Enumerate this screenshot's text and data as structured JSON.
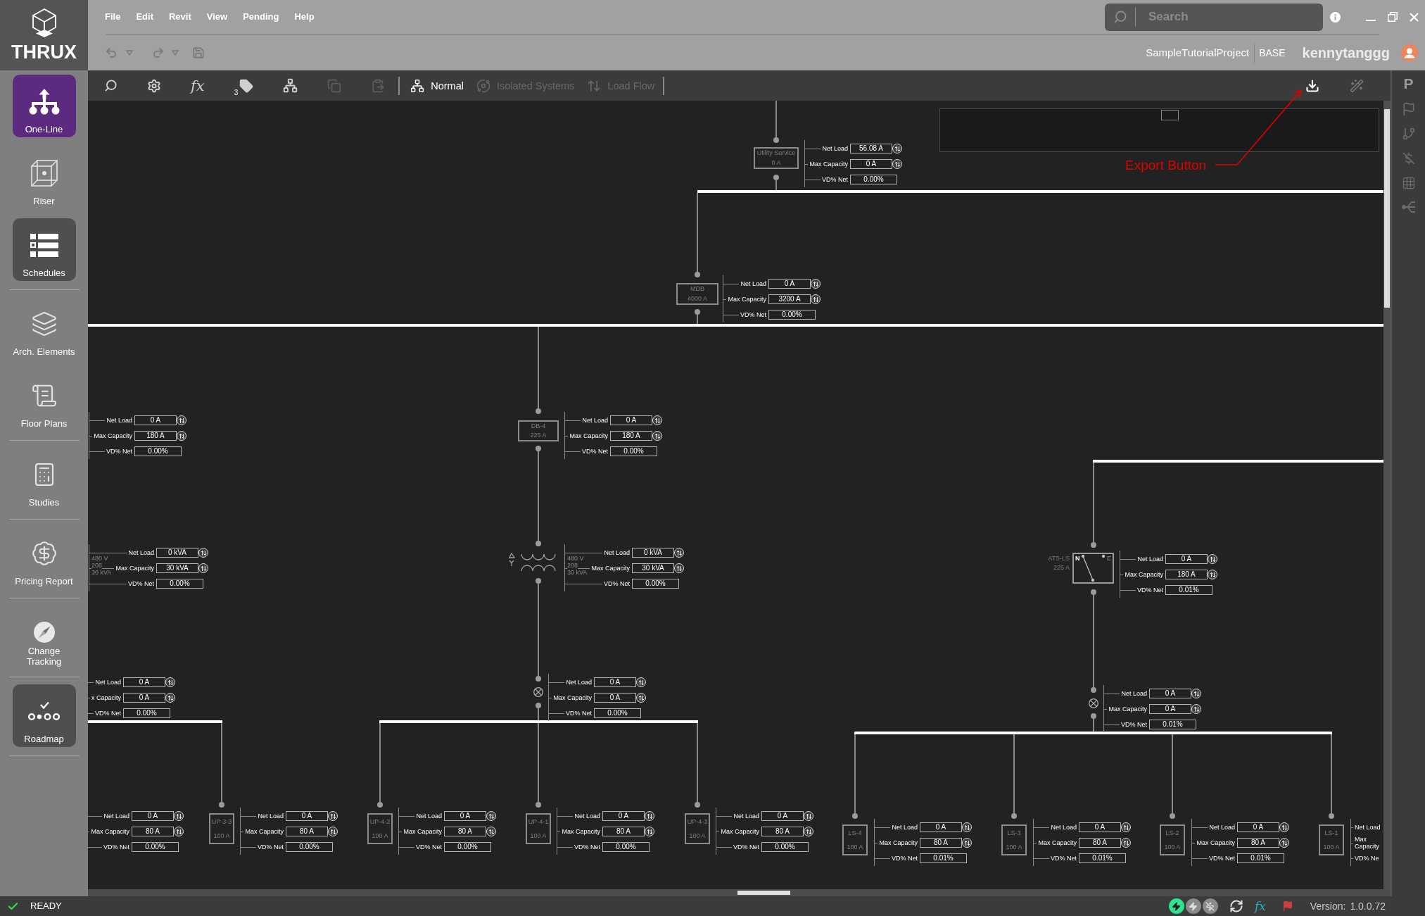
{
  "logo": {
    "text": "THRUX"
  },
  "sidebar": {
    "groups": [
      [
        {
          "label": "One-Line",
          "kind": "tile",
          "selected": true
        },
        {
          "label": "Riser",
          "kind": "plain",
          "selected": false
        },
        {
          "label": "Schedules",
          "kind": "tile",
          "selected": false
        }
      ],
      [
        {
          "label": "Arch. Elements",
          "kind": "plain",
          "selected": false
        },
        {
          "label": "Floor Plans",
          "kind": "plain",
          "selected": false
        }
      ],
      [
        {
          "label": "Studies",
          "kind": "plain",
          "selected": false
        }
      ],
      [
        {
          "label": "Pricing Report",
          "kind": "plain",
          "selected": false
        }
      ],
      [
        {
          "label": "Change Tracking",
          "kind": "plain",
          "selected": false
        }
      ],
      [
        {
          "label": "Roadmap",
          "kind": "tile",
          "selected": false
        }
      ]
    ]
  },
  "menu": [
    "File",
    "Edit",
    "Revit",
    "View",
    "Pending",
    "Help"
  ],
  "search": {
    "placeholder": "Search"
  },
  "project": {
    "name": "SampleTutorialProject",
    "branch": "BASE",
    "user": "kennytanggg"
  },
  "toolbar": {
    "tools": [
      {
        "disabled": false
      },
      {
        "disabled": false
      },
      {
        "disabled": false,
        "glyph": "fx"
      },
      {
        "disabled": false,
        "badge": "3"
      },
      {
        "disabled": false
      },
      {
        "disabled": true
      },
      {
        "disabled": true
      }
    ],
    "modes": [
      {
        "label": "Normal",
        "selected": true
      },
      {
        "label": "Isolated Systems",
        "selected": false
      },
      {
        "label": "Load Flow",
        "selected": false
      }
    ]
  },
  "right_rail": {
    "letter": "P"
  },
  "diagram": {
    "annotation": "Export Button",
    "nodes": [
      {
        "kind": "box",
        "name": "Utility Service",
        "rating": "0 A",
        "panel": {
          "rows": [
            {
              "kind": "toggle",
              "label": "Net Load",
              "value": "56.08 A"
            },
            {
              "kind": "toggle",
              "label": "Max Capacity",
              "value": "0 A"
            },
            {
              "kind": "plain",
              "label": "VD% Net",
              "value": "0.00%"
            }
          ]
        }
      },
      {
        "kind": "box",
        "name": "MDB",
        "rating": "4000 A",
        "panel": {
          "rows": [
            {
              "kind": "toggle",
              "label": "Net Load",
              "value": "0 A"
            },
            {
              "kind": "toggle",
              "label": "Max Capacity",
              "value": "3200 A"
            },
            {
              "kind": "plain",
              "label": "VD% Net",
              "value": "0.00%"
            }
          ]
        }
      },
      {
        "kind": "panel_only",
        "panel": {
          "rows": [
            {
              "kind": "toggle",
              "label": "Net Load",
              "value": "0 A"
            },
            {
              "kind": "toggle",
              "label": "Max Capacity",
              "value": "180 A"
            },
            {
              "kind": "plain",
              "label": "VD% Net",
              "value": "0.00%"
            }
          ]
        }
      },
      {
        "kind": "box",
        "name": "DB-4",
        "rating": "225 A",
        "panel": {
          "rows": [
            {
              "kind": "toggle",
              "label": "Net Load",
              "value": "0 A"
            },
            {
              "kind": "toggle",
              "label": "Max Capacity",
              "value": "180 A"
            },
            {
              "kind": "plain",
              "label": "VD% Net",
              "value": "0.00%"
            }
          ]
        }
      },
      {
        "kind": "panel_only",
        "panel": {
          "notes": [
            "480 V",
            "208",
            "30 kVA"
          ],
          "rows": [
            {
              "kind": "toggle",
              "label": "Net Load",
              "value": "0 kVA"
            },
            {
              "kind": "toggle",
              "label": "Max Capacity",
              "value": "30 kVA"
            },
            {
              "kind": "plain",
              "label": "VD% Net",
              "value": "0.00%"
            }
          ]
        }
      },
      {
        "kind": "transformer",
        "panel": {
          "notes": [
            "480 V",
            "208",
            "30 kVA"
          ],
          "rows": [
            {
              "kind": "toggle",
              "label": "Net Load",
              "value": "0 kVA"
            },
            {
              "kind": "toggle",
              "label": "Max Capacity",
              "value": "30 kVA"
            },
            {
              "kind": "plain",
              "label": "VD% Net",
              "value": "0.00%"
            }
          ]
        }
      },
      {
        "kind": "ats",
        "name": "ATS-LS",
        "rating": "225 A",
        "poles": [
          {
            "label": "N",
            "selected": true
          },
          {
            "label": "E",
            "selected": false
          }
        ],
        "panel": {
          "rows": [
            {
              "kind": "toggle",
              "label": "Net Load",
              "value": "0 A"
            },
            {
              "kind": "toggle",
              "label": "Max Capacity",
              "value": "180 A"
            },
            {
              "kind": "plain",
              "label": "VD% Net",
              "value": "0.01%"
            }
          ]
        }
      },
      {
        "kind": "panel_only",
        "panel": {
          "rows": [
            {
              "kind": "toggle",
              "label": "Net Load",
              "value": "0 A"
            },
            {
              "kind": "toggle",
              "label": "x Capacity",
              "value": "0 A"
            },
            {
              "kind": "plain",
              "label": "VD% Net",
              "value": "0.00%"
            }
          ]
        }
      },
      {
        "kind": "breaker",
        "panel": {
          "rows": [
            {
              "kind": "toggle",
              "label": "Net Load",
              "value": "0 A"
            },
            {
              "kind": "toggle",
              "label": "Max Capacity",
              "value": "0 A"
            },
            {
              "kind": "plain",
              "label": "VD% Net",
              "value": "0.00%"
            }
          ]
        }
      },
      {
        "kind": "breaker",
        "panel": {
          "rows": [
            {
              "kind": "toggle",
              "label": "Net Load",
              "value": "0 A"
            },
            {
              "kind": "toggle",
              "label": "Max Capacity",
              "value": "0 A"
            },
            {
              "kind": "plain",
              "label": "VD% Net",
              "value": "0.01%"
            }
          ]
        }
      },
      {
        "kind": "panel_only",
        "panel": {
          "rows": [
            {
              "kind": "toggle",
              "label": "Net Load",
              "value": "0 A"
            },
            {
              "kind": "toggle",
              "label": "Max Capacity",
              "value": "80 A"
            },
            {
              "kind": "plain",
              "label": "VD% Net",
              "value": "0.00%"
            }
          ]
        }
      },
      {
        "kind": "box",
        "name": "UP-3-3",
        "rating": "100 A",
        "panel": {
          "rows": [
            {
              "kind": "toggle",
              "label": "Net Load",
              "value": "0 A"
            },
            {
              "kind": "toggle",
              "label": "Max Capacity",
              "value": "80 A"
            },
            {
              "kind": "plain",
              "label": "VD% Net",
              "value": "0.00%"
            }
          ]
        }
      },
      {
        "kind": "box",
        "name": "UP-4-2",
        "rating": "100 A",
        "panel": {
          "rows": [
            {
              "kind": "toggle",
              "label": "Net Load",
              "value": "0 A"
            },
            {
              "kind": "toggle",
              "label": "Max Capacity",
              "value": "80 A"
            },
            {
              "kind": "plain",
              "label": "VD% Net",
              "value": "0.00%"
            }
          ]
        }
      },
      {
        "kind": "box",
        "name": "UP-4-1",
        "rating": "100 A",
        "panel": {
          "rows": [
            {
              "kind": "toggle",
              "label": "Net Load",
              "value": "0 A"
            },
            {
              "kind": "toggle",
              "label": "Max Capacity",
              "value": "80 A"
            },
            {
              "kind": "plain",
              "label": "VD% Net",
              "value": "0.00%"
            }
          ]
        }
      },
      {
        "kind": "box",
        "name": "UP-4-3",
        "rating": "100 A",
        "panel": {
          "rows": [
            {
              "kind": "toggle",
              "label": "Net Load",
              "value": "0 A"
            },
            {
              "kind": "toggle",
              "label": "Max Capacity",
              "value": "80 A"
            },
            {
              "kind": "plain",
              "label": "VD% Net",
              "value": "0.00%"
            }
          ]
        }
      },
      {
        "kind": "box",
        "name": "LS-4",
        "rating": "100 A",
        "panel": {
          "rows": [
            {
              "kind": "toggle",
              "label": "Net Load",
              "value": "0 A"
            },
            {
              "kind": "toggle",
              "label": "Max Capacity",
              "value": "80 A"
            },
            {
              "kind": "plain",
              "label": "VD% Net",
              "value": "0.01%"
            }
          ]
        }
      },
      {
        "kind": "box",
        "name": "LS-3",
        "rating": "100 A",
        "panel": {
          "rows": [
            {
              "kind": "toggle",
              "label": "Net Load",
              "value": "0 A"
            },
            {
              "kind": "toggle",
              "label": "Max Capacity",
              "value": "80 A"
            },
            {
              "kind": "plain",
              "label": "VD% Net",
              "value": "0.01%"
            }
          ]
        }
      },
      {
        "kind": "box",
        "name": "LS-2",
        "rating": "100 A",
        "panel": {
          "rows": [
            {
              "kind": "toggle",
              "label": "Net Load",
              "value": "0 A"
            },
            {
              "kind": "toggle",
              "label": "Max Capacity",
              "value": "80 A"
            },
            {
              "kind": "plain",
              "label": "VD% Net",
              "value": "0.01%"
            }
          ]
        }
      },
      {
        "kind": "box",
        "name": "LS-1",
        "rating": "100 A",
        "panel": {
          "rows": [
            {
              "kind": "label",
              "label": "Net Load"
            },
            {
              "kind": "label",
              "label": "Max Capacity"
            },
            {
              "kind": "label",
              "label": "VD% Ne"
            }
          ]
        }
      }
    ]
  },
  "status_bar": {
    "status": "READY",
    "indicators": [
      {
        "on": true
      },
      {
        "on": false
      },
      {
        "on": false
      }
    ],
    "formula_glyph": "fx",
    "version_label": "Version:",
    "version": "1.0.0.72"
  }
}
